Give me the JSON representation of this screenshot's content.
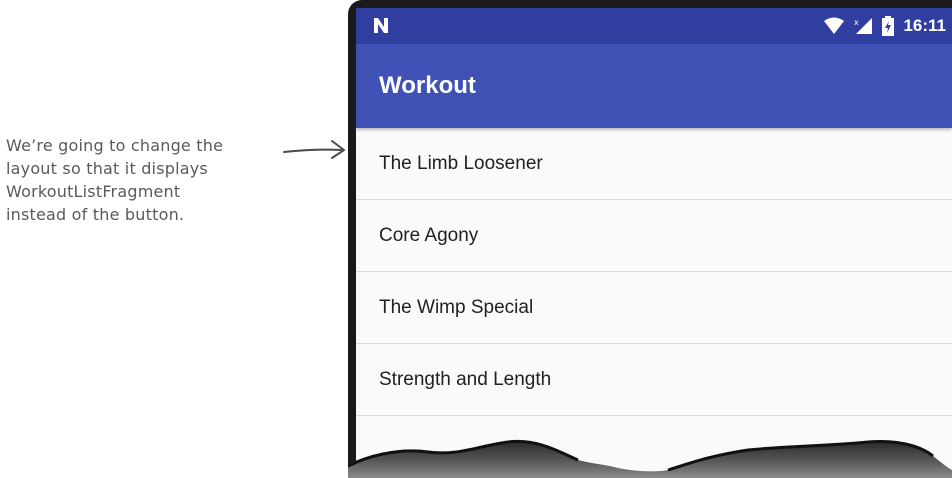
{
  "annotation": {
    "lines": [
      "We’re going to change the",
      "layout so that it displays",
      "WorkoutListFragment",
      "instead of the button."
    ]
  },
  "status_bar": {
    "time": "16:11",
    "icons": [
      "n-notification-icon",
      "wifi-icon",
      "cell-signal-icon",
      "battery-charging-icon"
    ]
  },
  "app_bar": {
    "title": "Workout"
  },
  "workouts": [
    "The Limb Loosener",
    "Core Agony",
    "The Wimp Special",
    "Strength and Length"
  ],
  "colors": {
    "primary": "#3f51b5",
    "primary_dark": "#303f9f",
    "list_background": "#fafafa",
    "divider": "#dcdcdc",
    "annotation_text": "#5a5a5a"
  }
}
